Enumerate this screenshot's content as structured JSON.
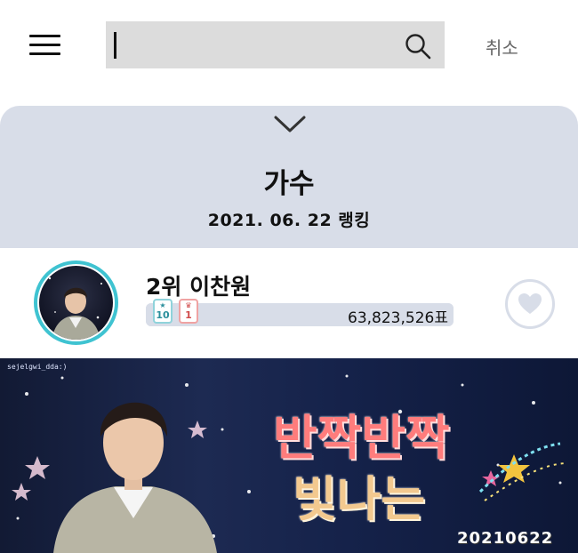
{
  "header": {
    "search_value": "",
    "cancel_label": "취소"
  },
  "panel": {
    "title": "가수",
    "date_label": "2021. 06. 22 랭킹"
  },
  "ranking": {
    "entry": {
      "rank_name": "2위 이찬원",
      "badge_a_value": "10",
      "badge_b_value": "1",
      "votes": "63,823,526표",
      "favorited": false
    }
  },
  "banner": {
    "handle": "sejelgwi_dda:)",
    "line1": "반짝반짝",
    "line2": "빛나는",
    "date": "20210622"
  },
  "colors": {
    "panel_bg": "#d8dde8",
    "avatar_ring": "#3fc3d1",
    "search_bg": "#dcdcdc"
  },
  "icons": {
    "menu": "hamburger-menu-icon",
    "search": "search-icon",
    "collapse": "chevron-down-icon",
    "favorite": "heart-icon"
  }
}
